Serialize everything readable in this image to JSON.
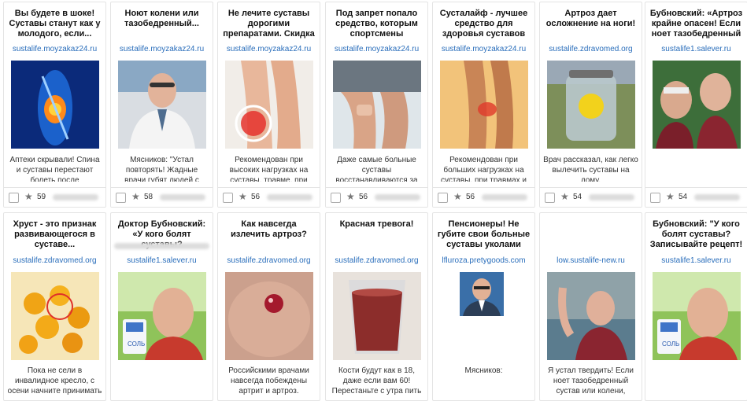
{
  "cards_row1": [
    {
      "title": "Вы будете в шоке! Суставы станут как у молодого, если...",
      "domain": "sustalife.moyzakaz24.ru",
      "desc": "Аптеки скрывали! Спина и суставы перестают болеть после",
      "rating": "59"
    },
    {
      "title": "Ноют колени или тазобедренный...",
      "domain": "sustalife.moyzakaz24.ru",
      "desc": "Мясников: \"Устал повторять! Жадные врачи губят людей с",
      "rating": "58"
    },
    {
      "title": "Не лечите суставы дорогими препаратами. Скидка",
      "domain": "sustalife.moyzakaz24.ru",
      "desc": "Рекомендован при высоких нагрузках на суставы, травме, при",
      "rating": "56"
    },
    {
      "title": "Под запрет попало средство, которым спортсмены",
      "domain": "sustalife.moyzakaz24.ru",
      "desc": "Даже самые больные суставы восстанавливаются за",
      "rating": "56"
    },
    {
      "title": "Сусталайф - лучшее средство для здоровья суставов",
      "domain": "sustalife.moyzakaz24.ru",
      "desc": "Рекомендован при больших нагрузках на суставы, при травмах и",
      "rating": "56"
    },
    {
      "title": "Артроз дает осложнение на ноги!",
      "domain": "sustalife.zdravomed.org",
      "desc": "Врач рассказал, как легко вылечить суставы на дому.",
      "rating": "54"
    },
    {
      "title": "Бубновский: «Артроз крайне опасен! Если ноет тазобедренный и",
      "domain": "sustalife1.salever.ru",
      "desc": "",
      "rating": "54"
    }
  ],
  "cards_row2": [
    {
      "title": "Хруст - это признак развивающегося в суставе...",
      "domain": "sustalife.zdravomed.org",
      "desc": "Пока не сели в инвалидное кресло, с осени начните принимать"
    },
    {
      "title": "Доктор Бубновский: «У кого болят суставы?",
      "domain": "sustalife1.salever.ru",
      "desc": ""
    },
    {
      "title": "Как навсегда излечить артроз?",
      "domain": "sustalife.zdravomed.org",
      "desc": "Российскими врачами навсегда побеждены артрит и артроз."
    },
    {
      "title": "Красная тревога!",
      "domain": "sustalife.zdravomed.org",
      "desc": "Кости будут как в 18, даже если вам 60! Перестаньте с утра пить"
    },
    {
      "title": "Пенсионеры! Не губите свои больные суставы уколами",
      "domain": "lfluroza.pretygoods.com",
      "desc": "Мясников:"
    },
    {
      "title": "",
      "domain": "low.sustalife-new.ru",
      "desc": "Я устал твердить! Если ноет тазобедренный сустав или колени,"
    },
    {
      "title": "Бубновский: \"У кого болят суставы? Записывайте рецепт!",
      "domain": "sustalife1.salever.ru",
      "desc": ""
    }
  ]
}
